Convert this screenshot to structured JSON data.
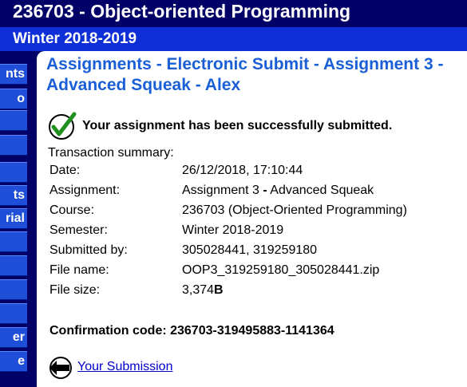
{
  "header": {
    "course_title": "236703 - Object-oriented Programming",
    "semester": "Winter 2018-2019"
  },
  "sidebar": {
    "items": [
      {
        "label": "nts"
      },
      {
        "label": "o"
      },
      {
        "label": ""
      },
      {
        "label": ""
      },
      {
        "label": ""
      },
      {
        "label": "ts"
      },
      {
        "label": "rial"
      },
      {
        "label": ""
      },
      {
        "label": ""
      },
      {
        "label": ""
      },
      {
        "label": ""
      },
      {
        "label": "er"
      },
      {
        "label": "e"
      }
    ]
  },
  "page": {
    "title": "Assignments - Electronic Submit - Assignment 3 - Advanced Squeak - Alex",
    "success_message": "Your assignment has been successfully submitted.",
    "summary_heading": "Transaction summary:",
    "summary": {
      "date": {
        "label": "Date:",
        "value": "26/12/2018, 17:10:44"
      },
      "assignment": {
        "label": "Assignment:",
        "value_start": "Assignment 3 ",
        "value_dash": "-",
        "value_end": " Advanced Squeak"
      },
      "course": {
        "label": "Course:",
        "value": "236703 (Object-Oriented Programming)"
      },
      "semester": {
        "label": "Semester:",
        "value": "Winter 2018-2019"
      },
      "submitted_by": {
        "label": "Submitted by:",
        "value": "305028441, 319259180"
      },
      "file_name": {
        "label": "File name:",
        "value": "OOP3_319259180_305028441.zip"
      },
      "file_size": {
        "label": "File size:",
        "value_number": "3,374",
        "value_unit": "B"
      }
    },
    "confirmation": "Confirmation code: 236703-319495883-1141364",
    "submission_link": "Your Submission"
  },
  "colors": {
    "header_bg": "#000066",
    "semester_bar": "#0f2fd6",
    "title_blue": "#1a5fd6",
    "link": "#0000cc",
    "check_green": "#1f8f1f"
  },
  "icons": {
    "success": "checkmark-circle-icon",
    "back": "back-arrow-circle-icon"
  }
}
